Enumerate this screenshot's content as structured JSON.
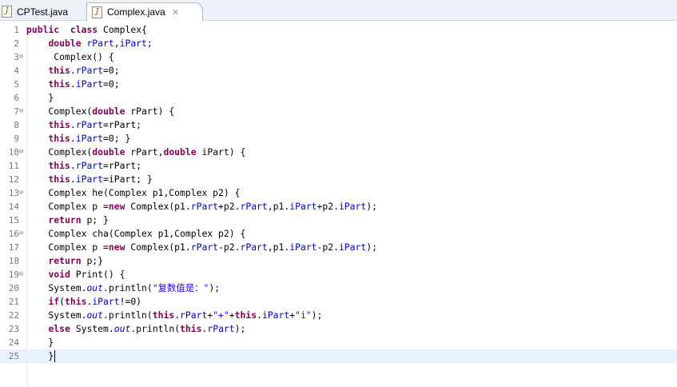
{
  "tabs": [
    {
      "label": "CPTest.java",
      "icon": "java-file-icon"
    },
    {
      "label": "Complex.java",
      "icon": "java-file-icon",
      "active": true,
      "close": "✕"
    }
  ],
  "code_lines": [
    {
      "number": "1",
      "fold": "",
      "tokens": [
        [
          "kw",
          "public"
        ],
        [
          "",
          "  "
        ],
        [
          "kw",
          "class"
        ],
        [
          "",
          " Complex{"
        ]
      ]
    },
    {
      "number": "2",
      "fold": "",
      "tokens": [
        [
          "",
          "    "
        ],
        [
          "kw",
          "double"
        ],
        [
          "",
          " "
        ],
        [
          "fld",
          "rPart"
        ],
        [
          "",
          ","
        ],
        [
          "fld",
          "iPart"
        ],
        [
          "",
          ";"
        ]
      ]
    },
    {
      "number": "3",
      "fold": "⊖",
      "tokens": [
        [
          "",
          "     Complex() {"
        ]
      ]
    },
    {
      "number": "4",
      "fold": "",
      "tokens": [
        [
          "",
          "    "
        ],
        [
          "kw",
          "this"
        ],
        [
          "",
          "."
        ],
        [
          "fld",
          "rPart"
        ],
        [
          "",
          "=0;"
        ]
      ]
    },
    {
      "number": "5",
      "fold": "",
      "tokens": [
        [
          "",
          "    "
        ],
        [
          "kw",
          "this"
        ],
        [
          "",
          "."
        ],
        [
          "fld",
          "iPart"
        ],
        [
          "",
          "=0;"
        ]
      ]
    },
    {
      "number": "6",
      "fold": "",
      "tokens": [
        [
          "",
          "    }"
        ]
      ]
    },
    {
      "number": "7",
      "fold": "⊖",
      "tokens": [
        [
          "",
          "    Complex("
        ],
        [
          "kw",
          "double"
        ],
        [
          "",
          " rPart) {"
        ]
      ]
    },
    {
      "number": "8",
      "fold": "",
      "tokens": [
        [
          "",
          "    "
        ],
        [
          "kw",
          "this"
        ],
        [
          "",
          "."
        ],
        [
          "fld",
          "rPart"
        ],
        [
          "",
          "=rPart;"
        ]
      ]
    },
    {
      "number": "9",
      "fold": "",
      "tokens": [
        [
          "",
          "    "
        ],
        [
          "kw",
          "this"
        ],
        [
          "",
          "."
        ],
        [
          "fld",
          "iPart"
        ],
        [
          "",
          "=0; }"
        ]
      ]
    },
    {
      "number": "10",
      "fold": "⊖",
      "tokens": [
        [
          "",
          "    Complex("
        ],
        [
          "kw",
          "double"
        ],
        [
          "",
          " rPart,"
        ],
        [
          "kw",
          "double"
        ],
        [
          "",
          " iPart) {"
        ]
      ]
    },
    {
      "number": "11",
      "fold": "",
      "tokens": [
        [
          "",
          "    "
        ],
        [
          "kw",
          "this"
        ],
        [
          "",
          "."
        ],
        [
          "fld",
          "rPart"
        ],
        [
          "",
          "=rPart;"
        ]
      ]
    },
    {
      "number": "12",
      "fold": "",
      "tokens": [
        [
          "",
          "    "
        ],
        [
          "kw",
          "this"
        ],
        [
          "",
          "."
        ],
        [
          "fld",
          "iPart"
        ],
        [
          "",
          "=iPart; }"
        ]
      ]
    },
    {
      "number": "13",
      "fold": "⊖",
      "tokens": [
        [
          "",
          "    Complex he(Complex p1,Complex p2) {"
        ]
      ]
    },
    {
      "number": "14",
      "fold": "",
      "tokens": [
        [
          "",
          "    Complex p ="
        ],
        [
          "kw",
          "new"
        ],
        [
          "",
          " Complex(p1."
        ],
        [
          "fld",
          "rPart"
        ],
        [
          "",
          "+p2."
        ],
        [
          "fld",
          "rPart"
        ],
        [
          "",
          ",p1."
        ],
        [
          "fld",
          "iPart"
        ],
        [
          "",
          "+p2."
        ],
        [
          "fld",
          "iPart"
        ],
        [
          "",
          ");"
        ]
      ]
    },
    {
      "number": "15",
      "fold": "",
      "tokens": [
        [
          "",
          "    "
        ],
        [
          "kw",
          "return"
        ],
        [
          "",
          " p; }"
        ]
      ]
    },
    {
      "number": "16",
      "fold": "⊖",
      "tokens": [
        [
          "",
          "    Complex cha(Complex p1,Complex p2) {"
        ]
      ]
    },
    {
      "number": "17",
      "fold": "",
      "tokens": [
        [
          "",
          "    Complex p ="
        ],
        [
          "kw",
          "new"
        ],
        [
          "",
          " Complex(p1."
        ],
        [
          "fld",
          "rPart"
        ],
        [
          "",
          "-p2."
        ],
        [
          "fld",
          "rPart"
        ],
        [
          "",
          ",p1."
        ],
        [
          "fld",
          "iPart"
        ],
        [
          "",
          "-p2."
        ],
        [
          "fld",
          "iPart"
        ],
        [
          "",
          ");"
        ]
      ]
    },
    {
      "number": "18",
      "fold": "",
      "tokens": [
        [
          "",
          "    "
        ],
        [
          "kw",
          "return"
        ],
        [
          "",
          " p;}"
        ]
      ]
    },
    {
      "number": "19",
      "fold": "⊖",
      "tokens": [
        [
          "",
          "    "
        ],
        [
          "kw",
          "void"
        ],
        [
          "",
          " Print() {"
        ]
      ]
    },
    {
      "number": "20",
      "fold": "",
      "tokens": [
        [
          "",
          "    System."
        ],
        [
          "st",
          "out"
        ],
        [
          "",
          ".println("
        ],
        [
          "str",
          "\"复数值是：\""
        ],
        [
          "",
          ");"
        ]
      ]
    },
    {
      "number": "21",
      "fold": "",
      "tokens": [
        [
          "",
          "    "
        ],
        [
          "kw",
          "if"
        ],
        [
          "",
          "("
        ],
        [
          "kw",
          "this"
        ],
        [
          "",
          "."
        ],
        [
          "fld",
          "iPart"
        ],
        [
          "",
          "!=0)"
        ]
      ]
    },
    {
      "number": "22",
      "fold": "",
      "tokens": [
        [
          "",
          "    System."
        ],
        [
          "st",
          "out"
        ],
        [
          "",
          ".println("
        ],
        [
          "kw",
          "this"
        ],
        [
          "",
          "."
        ],
        [
          "fld",
          "rPart"
        ],
        [
          "",
          "+"
        ],
        [
          "str",
          "\"+\""
        ],
        [
          "",
          "+"
        ],
        [
          "kw",
          "this"
        ],
        [
          "",
          "."
        ],
        [
          "fld",
          "iPart"
        ],
        [
          "",
          "+"
        ],
        [
          "str",
          "\"i\""
        ],
        [
          "",
          ");"
        ]
      ]
    },
    {
      "number": "23",
      "fold": "",
      "tokens": [
        [
          "",
          "    "
        ],
        [
          "kw",
          "else"
        ],
        [
          "",
          " System."
        ],
        [
          "st",
          "out"
        ],
        [
          "",
          ".println("
        ],
        [
          "kw",
          "this"
        ],
        [
          "",
          "."
        ],
        [
          "fld",
          "rPart"
        ],
        [
          "",
          ");"
        ]
      ]
    },
    {
      "number": "24",
      "fold": "",
      "tokens": [
        [
          "",
          "    }"
        ]
      ]
    },
    {
      "number": "25",
      "fold": "",
      "tokens": [
        [
          "",
          "    }"
        ]
      ],
      "current": true
    }
  ]
}
